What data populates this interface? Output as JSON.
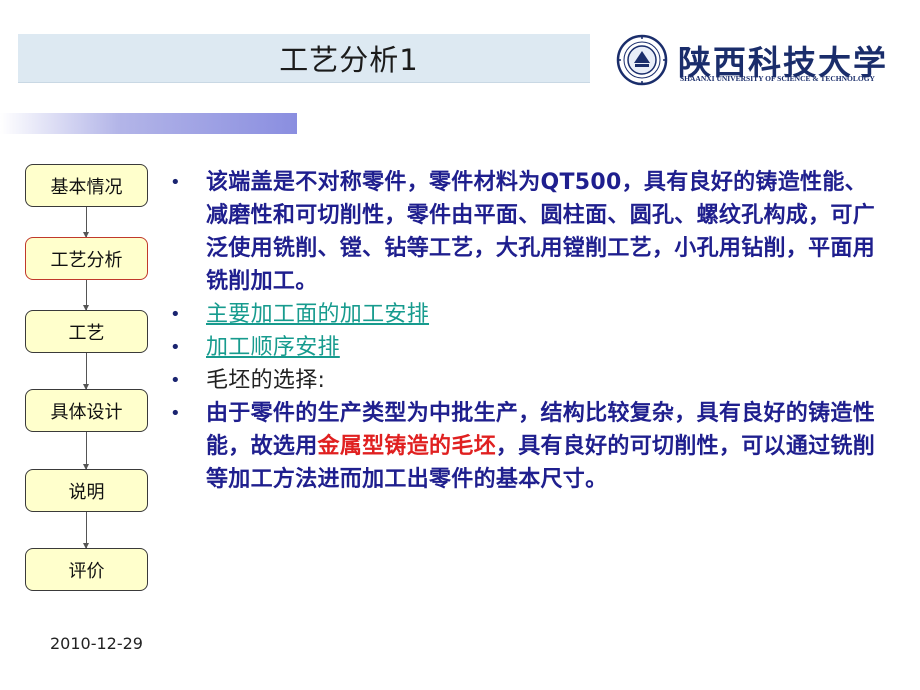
{
  "title": "工艺分析1",
  "logo": {
    "name_cn": "陕西科技大学",
    "name_en": "SHAANXI UNIVERSITY OF SCIENCE & TECHNOLOGY"
  },
  "nav": {
    "items": [
      {
        "label": "基本情况"
      },
      {
        "label": "工艺分析",
        "active": true
      },
      {
        "label": "工艺"
      },
      {
        "label": "具体设计"
      },
      {
        "label": "说明"
      },
      {
        "label": "评价"
      }
    ]
  },
  "bullets": {
    "b1": "该端盖是不对称零件，零件材料为QT500，具有良好的铸造性能、减磨性和可切削性，零件由平面、圆柱面、圆孔、螺纹孔构成，可广泛使用铣削、镗、钻等工艺，大孔用镗削工艺，小孔用钻削，平面用铣削加工。",
    "b2": "主要加工面的加工安排",
    "b3": "加工顺序安排",
    "b4": "毛坯的选择:",
    "b5_pre": "由于零件的生产类型为中批生产，结构比较复杂，具有良好的铸造性能，故选用",
    "b5_red": "金属型铸造的毛坯",
    "b5_post": "，具有良好的可切削性，可以通过铣削等加工方法进而加工出零件的基本尺寸。",
    "marker": "•"
  },
  "footer": {
    "date": "2010-12-29"
  },
  "colors": {
    "title_bar": "#dde9f2",
    "nav_fill": "#ffffcc",
    "text_main": "#1f1f8e",
    "link": "#179b8e",
    "highlight": "#e02020",
    "logo": "#1a2d6b"
  }
}
